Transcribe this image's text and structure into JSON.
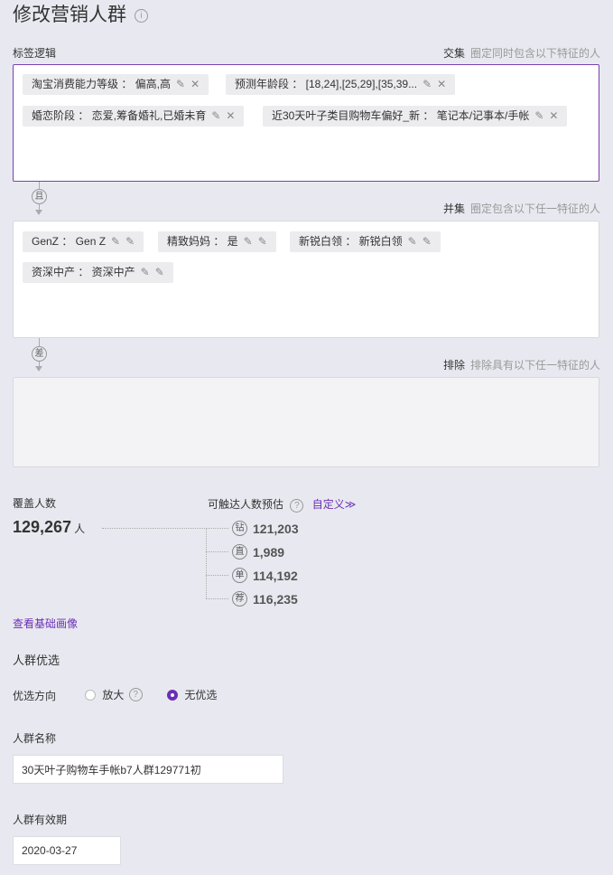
{
  "page": {
    "title": "修改营销人群"
  },
  "label_logic": {
    "label": "标签逻辑"
  },
  "intersection": {
    "title": "交集",
    "desc": "圈定同时包含以下特征的人",
    "tags": [
      "淘宝消费能力等级 ： 偏高,高",
      "预测年龄段 ： [18,24],[25,29],[35,39...",
      "婚恋阶段 ： 恋爱,筹备婚礼,已婚未育",
      "近30天叶子类目购物车偏好_新 ： 笔记本/记事本/手帐"
    ]
  },
  "connector_and": "且",
  "union": {
    "title": "并集",
    "desc": "圈定包含以下任一特征的人",
    "tags": [
      "GenZ ： Gen Z",
      "精致妈妈 ： 是",
      "新锐白领 ： 新锐白领",
      "资深中产 ： 资深中产"
    ]
  },
  "connector_diff": "差",
  "exclude": {
    "title": "排除",
    "desc": "排除具有以下任一特征的人"
  },
  "coverage": {
    "label": "覆盖人数",
    "value": "129,267",
    "unit": "人"
  },
  "reach": {
    "label": "可触达人数预估",
    "custom_link": "自定义≫",
    "channels": [
      {
        "badge": "钻",
        "value": "121,203"
      },
      {
        "badge": "直",
        "value": "1,989"
      },
      {
        "badge": "单",
        "value": "114,192"
      },
      {
        "badge": "荐",
        "value": "116,235"
      }
    ]
  },
  "view_profile_link": "查看基础画像",
  "optimize": {
    "title": "人群优选",
    "direction_label": "优选方向",
    "option_amplify": "放大",
    "option_none": "无优选",
    "selected": "无优选"
  },
  "crowd_name": {
    "label": "人群名称",
    "value": "30天叶子购物车手帐b7人群129771初"
  },
  "validity": {
    "label": "人群有效期",
    "value": "2020-03-27"
  },
  "colors": {
    "accent": "#6b2fb5",
    "background": "#e8e9f0"
  }
}
